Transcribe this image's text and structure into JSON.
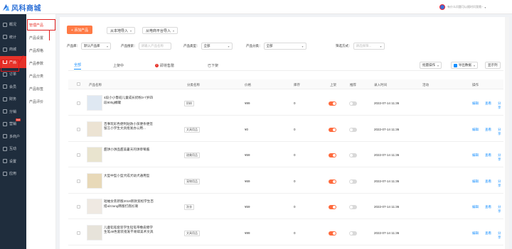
{
  "topbar": {
    "logo_text": "风科商城",
    "search_hint": "有什么问题可以随时问我哦~",
    "colors": {
      "accent": "#e6332a",
      "brand": "#2b6fd6",
      "link": "#1890ff",
      "add_button": "#ff7a45"
    }
  },
  "sidebar": {
    "items": [
      {
        "label": "概况",
        "icon": "home-icon"
      },
      {
        "label": "统计",
        "icon": "chart-icon"
      },
      {
        "label": "商城",
        "icon": "store-icon"
      },
      {
        "label": "产品",
        "icon": "grid-icon",
        "active": true
      },
      {
        "label": "订单",
        "icon": "order-icon"
      },
      {
        "label": "会员",
        "icon": "user-icon"
      },
      {
        "label": "财务",
        "icon": "money-icon"
      },
      {
        "label": "分销",
        "icon": "share-icon"
      },
      {
        "label": "营销",
        "icon": "marketing-icon",
        "badge": "hot"
      },
      {
        "label": "多商户",
        "icon": "merchant-icon"
      },
      {
        "label": "互动",
        "icon": "chat-icon"
      },
      {
        "label": "设置",
        "icon": "gear-icon"
      },
      {
        "label": "应用",
        "icon": "apps-icon"
      }
    ]
  },
  "subsidebar": {
    "items": [
      {
        "label": "管理产品",
        "active": true
      },
      {
        "label": "产品设置"
      },
      {
        "label": "产品规格"
      },
      {
        "label": "产品参数"
      },
      {
        "label": "产品分类"
      },
      {
        "label": "产品标签"
      },
      {
        "label": "产品评价"
      }
    ]
  },
  "toolbar": {
    "add_label": "+ 添加产品",
    "import_local": "从本地导入",
    "import_platform": "从电商平台导入"
  },
  "filters": {
    "library_label": "产品库：",
    "library_value": "默认产品库",
    "search_label": "产品搜索：",
    "search_placeholder": "请输入产品名称",
    "type_label": "产品类型：",
    "type_value": "全部",
    "category_label": "产品分类：",
    "category_value": "全部",
    "sort_label": "筛选方式：",
    "sort_placeholder": "请选择筛..."
  },
  "tabs": [
    {
      "label": "全部",
      "active": true
    },
    {
      "label": "上架中"
    },
    {
      "label": "即将售罄",
      "warn": true
    },
    {
      "label": "已下架"
    }
  ],
  "right_buttons": {
    "batch": "批量操作",
    "export": "导出数据",
    "display": "显示列"
  },
  "table": {
    "headers": {
      "name": "产品名称",
      "category": "分类名称",
      "price": "价格",
      "stock": "库存",
      "onsale": "上架",
      "recommend": "推荐",
      "entry_time": "录入时间",
      "activity": "活动",
      "actions": "操作"
    },
    "rows": [
      {
        "name": "4段小小鲁班儿童成长奶粉3-7岁四段800g桶罐",
        "category": "奶粉",
        "price": "¥99",
        "stock": "0",
        "onsale": true,
        "recommend": false,
        "time": "2022-07-14 11:36"
      },
      {
        "name": "百事玩彩色便利贴防小孩便条便签留言小学生文具批发办公用...",
        "category": "文具用品",
        "price": "¥0",
        "stock": "0",
        "onsale": true,
        "recommend": false,
        "time": "2022-07-14 11:36"
      },
      {
        "name": "甜饼小饼品甜美暑天的饼草莓酱",
        "category": "甜美用品",
        "price": "¥59",
        "stock": "0",
        "onsale": true,
        "recommend": false,
        "time": "2022-07-14 11:36"
      },
      {
        "name": "大型中型小型犬成犬幼犬通用型",
        "category": "宠物用品",
        "price": "¥69",
        "stock": "0",
        "onsale": true,
        "recommend": false,
        "time": "2022-07-14 11:36"
      },
      {
        "name": "短袖女装新版2018新款宽松学生百搭ulzzang韩版打底衫潮",
        "category": "洗衣",
        "price": "¥59",
        "stock": "0",
        "onsale": true,
        "recommend": false,
        "time": "2022-07-14 11:36"
      },
      {
        "name": "儿童铅笔套装学生铅笔带橡皮擦学生笔48色套装批发不易碎美术文具",
        "category": "文具用品",
        "price": "¥99",
        "stock": "0",
        "onsale": true,
        "recommend": false,
        "time": "2022-07-14 11:36"
      }
    ],
    "actions": {
      "edit": "编辑",
      "view": "查看",
      "share": "分享"
    }
  }
}
